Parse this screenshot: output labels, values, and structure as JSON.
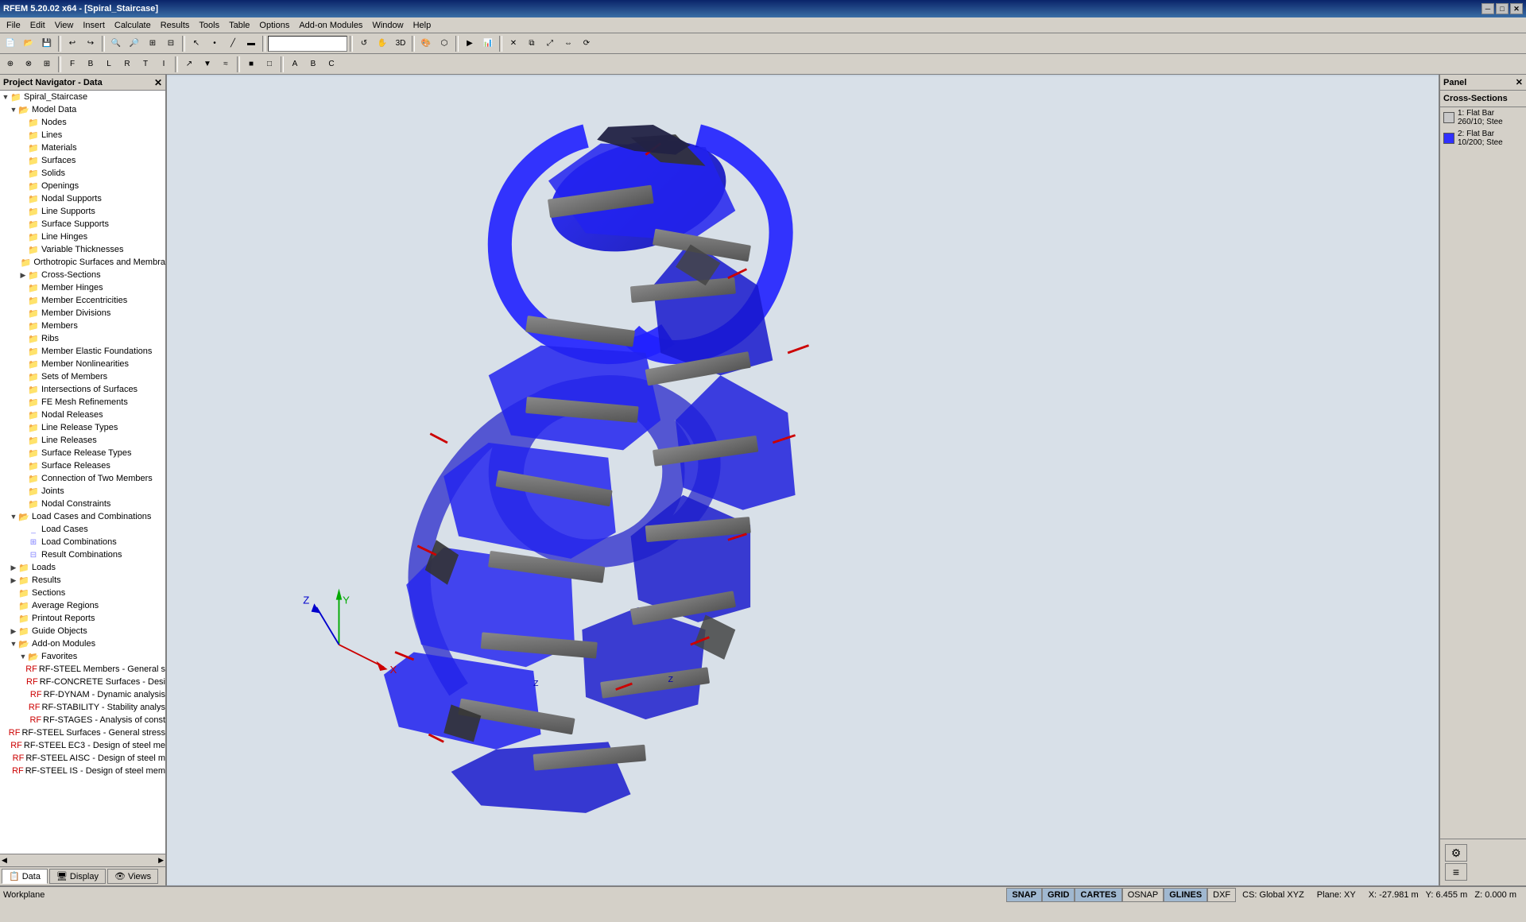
{
  "titleBar": {
    "title": "RFEM 5.20.02 x64 - [Spiral_Staircase]",
    "controls": [
      "minimize",
      "maximize",
      "close"
    ]
  },
  "menuBar": {
    "items": [
      "File",
      "Edit",
      "View",
      "Insert",
      "Calculate",
      "Results",
      "Tools",
      "Table",
      "Options",
      "Add-on Modules",
      "Window",
      "Help"
    ]
  },
  "navigatorHeader": "Project Navigator - Data",
  "treeItems": [
    {
      "id": "spiral-staircase",
      "label": "Spiral_Staircase",
      "level": 0,
      "type": "root",
      "expanded": true
    },
    {
      "id": "model-data",
      "label": "Model Data",
      "level": 1,
      "type": "folder",
      "expanded": true
    },
    {
      "id": "nodes",
      "label": "Nodes",
      "level": 2,
      "type": "item"
    },
    {
      "id": "lines",
      "label": "Lines",
      "level": 2,
      "type": "item"
    },
    {
      "id": "materials",
      "label": "Materials",
      "level": 2,
      "type": "item"
    },
    {
      "id": "surfaces",
      "label": "Surfaces",
      "level": 2,
      "type": "item"
    },
    {
      "id": "solids",
      "label": "Solids",
      "level": 2,
      "type": "item"
    },
    {
      "id": "openings",
      "label": "Openings",
      "level": 2,
      "type": "item"
    },
    {
      "id": "nodal-supports",
      "label": "Nodal Supports",
      "level": 2,
      "type": "item"
    },
    {
      "id": "line-supports",
      "label": "Line Supports",
      "level": 2,
      "type": "item"
    },
    {
      "id": "surface-supports",
      "label": "Surface Supports",
      "level": 2,
      "type": "item"
    },
    {
      "id": "line-hinges",
      "label": "Line Hinges",
      "level": 2,
      "type": "item"
    },
    {
      "id": "variable-thicknesses",
      "label": "Variable Thicknesses",
      "level": 2,
      "type": "item"
    },
    {
      "id": "orthotropic",
      "label": "Orthotropic Surfaces and Membra",
      "level": 2,
      "type": "item"
    },
    {
      "id": "cross-sections",
      "label": "Cross-Sections",
      "level": 2,
      "type": "folder",
      "expanded": false
    },
    {
      "id": "member-hinges",
      "label": "Member Hinges",
      "level": 2,
      "type": "item"
    },
    {
      "id": "member-eccentricities",
      "label": "Member Eccentricities",
      "level": 2,
      "type": "item"
    },
    {
      "id": "member-divisions",
      "label": "Member Divisions",
      "level": 2,
      "type": "item"
    },
    {
      "id": "members",
      "label": "Members",
      "level": 2,
      "type": "item"
    },
    {
      "id": "ribs",
      "label": "Ribs",
      "level": 2,
      "type": "item"
    },
    {
      "id": "member-elastic-foundations",
      "label": "Member Elastic Foundations",
      "level": 2,
      "type": "item"
    },
    {
      "id": "member-nonlinearities",
      "label": "Member Nonlinearities",
      "level": 2,
      "type": "item"
    },
    {
      "id": "sets-of-members",
      "label": "Sets of Members",
      "level": 2,
      "type": "item"
    },
    {
      "id": "intersections-of-surfaces",
      "label": "Intersections of Surfaces",
      "level": 2,
      "type": "item"
    },
    {
      "id": "fe-mesh-refinements",
      "label": "FE Mesh Refinements",
      "level": 2,
      "type": "item"
    },
    {
      "id": "nodal-releases",
      "label": "Nodal Releases",
      "level": 2,
      "type": "item"
    },
    {
      "id": "line-release-types",
      "label": "Line Release Types",
      "level": 2,
      "type": "item"
    },
    {
      "id": "line-releases",
      "label": "Line Releases",
      "level": 2,
      "type": "item"
    },
    {
      "id": "surface-release-types",
      "label": "Surface Release Types",
      "level": 2,
      "type": "item"
    },
    {
      "id": "surface-releases",
      "label": "Surface Releases",
      "level": 2,
      "type": "item"
    },
    {
      "id": "connection-two-members",
      "label": "Connection of Two Members",
      "level": 2,
      "type": "item"
    },
    {
      "id": "joints",
      "label": "Joints",
      "level": 2,
      "type": "item"
    },
    {
      "id": "nodal-constraints",
      "label": "Nodal Constraints",
      "level": 2,
      "type": "item"
    },
    {
      "id": "load-cases-combinations",
      "label": "Load Cases and Combinations",
      "level": 1,
      "type": "folder",
      "expanded": true
    },
    {
      "id": "load-cases",
      "label": "Load Cases",
      "level": 2,
      "type": "item"
    },
    {
      "id": "load-combinations",
      "label": "Load Combinations",
      "level": 2,
      "type": "item"
    },
    {
      "id": "result-combinations",
      "label": "Result Combinations",
      "level": 2,
      "type": "item"
    },
    {
      "id": "loads",
      "label": "Loads",
      "level": 1,
      "type": "folder",
      "expanded": false
    },
    {
      "id": "results",
      "label": "Results",
      "level": 1,
      "type": "folder",
      "expanded": false
    },
    {
      "id": "sections",
      "label": "Sections",
      "level": 1,
      "type": "item"
    },
    {
      "id": "average-regions",
      "label": "Average Regions",
      "level": 1,
      "type": "item"
    },
    {
      "id": "printout-reports",
      "label": "Printout Reports",
      "level": 1,
      "type": "item"
    },
    {
      "id": "guide-objects",
      "label": "Guide Objects",
      "level": 1,
      "type": "folder",
      "expanded": false
    },
    {
      "id": "add-on-modules",
      "label": "Add-on Modules",
      "level": 1,
      "type": "folder",
      "expanded": true
    },
    {
      "id": "favorites",
      "label": "Favorites",
      "level": 2,
      "type": "folder",
      "expanded": true
    },
    {
      "id": "rf-steel-members",
      "label": "RF-STEEL Members - General s",
      "level": 3,
      "type": "addon"
    },
    {
      "id": "rf-concrete-surfaces",
      "label": "RF-CONCRETE Surfaces - Desi",
      "level": 3,
      "type": "addon"
    },
    {
      "id": "rf-dynam",
      "label": "RF-DYNAM - Dynamic analysis",
      "level": 3,
      "type": "addon"
    },
    {
      "id": "rf-stability",
      "label": "RF-STABILITY - Stability analys",
      "level": 3,
      "type": "addon"
    },
    {
      "id": "rf-stages",
      "label": "RF-STAGES - Analysis of const",
      "level": 3,
      "type": "addon"
    },
    {
      "id": "rf-steel-surfaces",
      "label": "RF-STEEL Surfaces - General stress",
      "level": 3,
      "type": "addon"
    },
    {
      "id": "rf-steel-ec3",
      "label": "RF-STEEL EC3 - Design of steel me",
      "level": 3,
      "type": "addon"
    },
    {
      "id": "rf-steel-aisc",
      "label": "RF-STEEL AISC - Design of steel m",
      "level": 3,
      "type": "addon"
    },
    {
      "id": "rf-steel-is",
      "label": "RF-STEEL IS - Design of steel mem",
      "level": 3,
      "type": "addon"
    }
  ],
  "panel": {
    "title": "Panel",
    "crossSectionsTitle": "Cross-Sections",
    "items": [
      {
        "id": 1,
        "color": "#c8c8c8",
        "label": "1: Flat Bar 260/10; Stee"
      },
      {
        "id": 2,
        "color": "#3030ff",
        "label": "2: Flat Bar 10/200; Stee"
      }
    ]
  },
  "navTabs": [
    {
      "id": "data",
      "label": "Data",
      "icon": "📋",
      "active": true
    },
    {
      "id": "display",
      "label": "Display",
      "icon": "🖥"
    },
    {
      "id": "views",
      "label": "Views",
      "icon": "👁"
    }
  ],
  "statusBar": {
    "workspace": "Workplane",
    "buttons": [
      "SNAP",
      "GRID",
      "CARTES",
      "OSNAP",
      "GLINES",
      "DXF"
    ],
    "activeButtons": [
      "SNAP",
      "GRID",
      "CARTES",
      "GLINES"
    ],
    "cs": "CS: Global XYZ",
    "plane": "Plane: XY",
    "coords": "X: -27.981 m  Y: 6.455 m  Z: 0.000 m"
  }
}
